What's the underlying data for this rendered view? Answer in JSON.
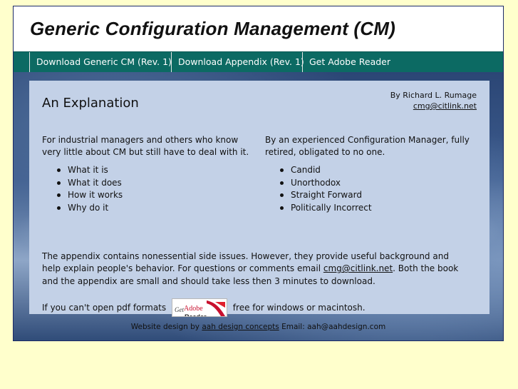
{
  "header": {
    "title": "Generic Configuration Management (CM)"
  },
  "nav": {
    "items": [
      {
        "label": "Download Generic CM (Rev. 1)"
      },
      {
        "label": "Download Appendix (Rev. 1)"
      },
      {
        "label": "Get Adobe Reader"
      }
    ]
  },
  "main": {
    "title": "An Explanation",
    "byline": {
      "author": "By Richard L. Rumage",
      "email": "cmg@citlink.net"
    },
    "left": {
      "intro": "For industrial managers and others who know very little about CM but still have to deal with it.",
      "items": [
        "What it is",
        "What it does",
        "How it works",
        "Why do it"
      ]
    },
    "right": {
      "intro": "By an experienced Configuration Manager, fully retired, obligated to no one.",
      "items": [
        "Candid",
        "Unorthodox",
        "Straight Forward",
        "Politically Incorrect"
      ]
    },
    "appendix": {
      "text_before": "The appendix contains nonessential side issues. However, they provide useful background and help explain people's behavior. For questions or comments email ",
      "email": "cmg@citlink.net",
      "text_after": ". Both the book and the appendix are small and should take less then 3 minutes to download."
    },
    "pdf": {
      "text_before": "If you can't open pdf formats",
      "badge_get": "Get",
      "badge_adobe": "Adobe",
      "badge_reader": "Reader",
      "text_after": "free for windows or macintosh."
    }
  },
  "footer": {
    "prefix": "Website design by",
    "link": "aah design concepts",
    "suffix": "Email: aah@aahdesign.com"
  },
  "colors": {
    "page_bg": "#ffffcc",
    "nav_bg": "#0c6a63",
    "panel_bg": "#c3d1e7",
    "frame_border": "#1c2a66",
    "adobe_red": "#c8102e"
  }
}
